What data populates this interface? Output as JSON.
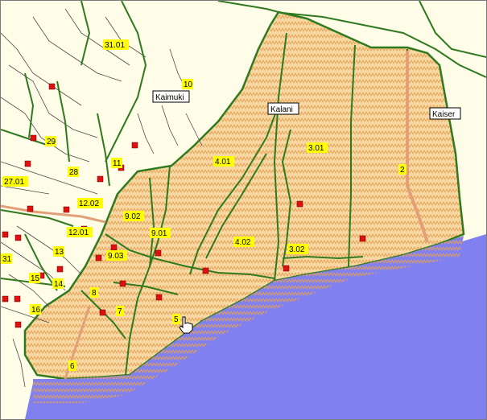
{
  "map": {
    "colors": {
      "background": "#fffde8",
      "ocean": "#8080f0",
      "highlight_fill": "#f7d9a6",
      "hatch": "#e6a050",
      "boundary": "#2f7a1f",
      "roads": "#4a4a4a",
      "marker": "#e01010",
      "major_road": "#e2a07a"
    },
    "place_labels": [
      {
        "text": "Kaimuki"
      },
      {
        "text": "Kalani"
      },
      {
        "text": "Kaiser"
      }
    ],
    "tract_labels": [
      {
        "text": "31.01"
      },
      {
        "text": "10"
      },
      {
        "text": "29"
      },
      {
        "text": "28"
      },
      {
        "text": "27.01"
      },
      {
        "text": "11"
      },
      {
        "text": "12.02"
      },
      {
        "text": "12.01"
      },
      {
        "text": "13"
      },
      {
        "text": "15"
      },
      {
        "text": "14"
      },
      {
        "text": "16"
      },
      {
        "text": "31"
      },
      {
        "text": "9.02"
      },
      {
        "text": "9.01"
      },
      {
        "text": "9.03"
      },
      {
        "text": "8"
      },
      {
        "text": "7"
      },
      {
        "text": "6"
      },
      {
        "text": "5"
      },
      {
        "text": "4.01"
      },
      {
        "text": "4.02"
      },
      {
        "text": "3.01"
      },
      {
        "text": "3.02"
      },
      {
        "text": "2"
      }
    ],
    "cursor": "hand-pointer-icon"
  }
}
